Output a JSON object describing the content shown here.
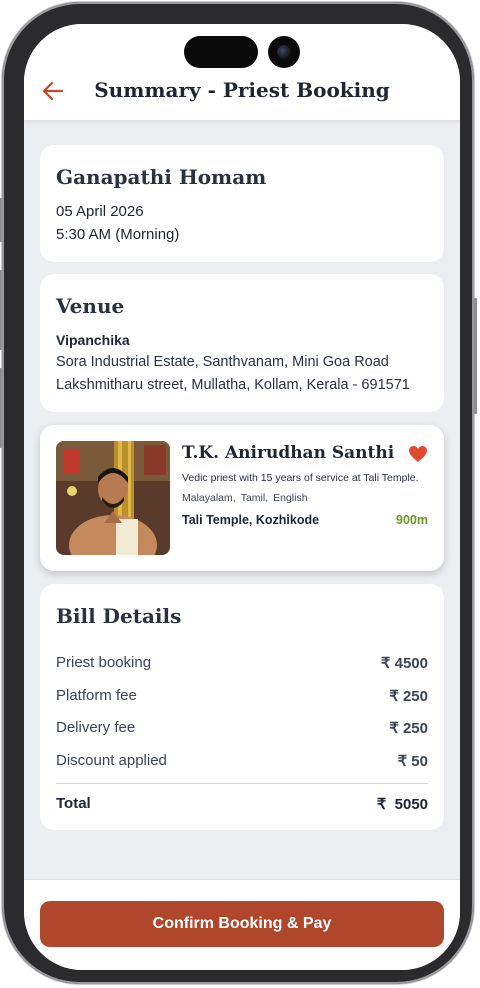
{
  "header": {
    "title": "Summary - Priest Booking",
    "back_icon": "arrow-left-icon",
    "accent": "#c2482a"
  },
  "service": {
    "name": "Ganapathi Homam",
    "date": "05 April 2026",
    "time": "5:30 AM (Morning)"
  },
  "venue": {
    "heading": "Venue",
    "name": "Vipanchika",
    "address_line1": "Sora Industrial Estate, Santhvanam, Mini Goa Road",
    "address_line2": "Lakshmitharu street, Mullatha, Kollam, Kerala - 691571"
  },
  "priest": {
    "name": "T.K. Anirudhan Santhi",
    "bio": "Vedic priest with 15 years of service at Tali Temple.",
    "languages": [
      "Malayalam,",
      "Tamil,",
      "English"
    ],
    "temple": "Tali Temple, Kozhikode",
    "distance": "900m",
    "favorite_icon": "heart-icon",
    "favorite_color": "#e04a32",
    "distance_color": "#6a9a1f"
  },
  "bill": {
    "heading": "Bill Details",
    "items": [
      {
        "label": "Priest booking",
        "value": "₹ 4500"
      },
      {
        "label": "Platform fee",
        "value": "₹ 250"
      },
      {
        "label": "Delivery fee",
        "value": "₹ 250"
      },
      {
        "label": "Discount applied",
        "value": "₹ 50"
      }
    ],
    "total_label": "Total",
    "total_value": "₹  5050"
  },
  "footer": {
    "cta_label": "Confirm Booking & Pay",
    "cta_color": "#b0462b"
  }
}
